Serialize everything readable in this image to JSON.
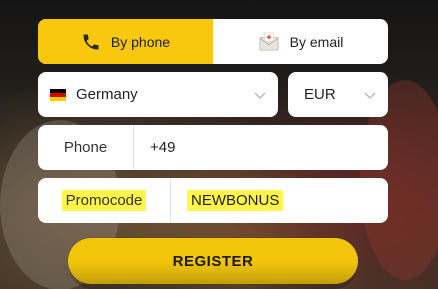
{
  "tabs": {
    "phone_label": "By phone",
    "email_label": "By email",
    "active": "phone",
    "accent_color": "#f7c80d"
  },
  "country": {
    "selected": "Germany",
    "flag": "germany-flag"
  },
  "currency": {
    "selected": "EUR"
  },
  "phone": {
    "label": "Phone",
    "value": "+49"
  },
  "promo": {
    "label": "Promocode",
    "value": "NEWBONUS",
    "highlight_color": "#fff44a"
  },
  "register": {
    "label": "REGISTER",
    "color": "#f2c50a"
  }
}
